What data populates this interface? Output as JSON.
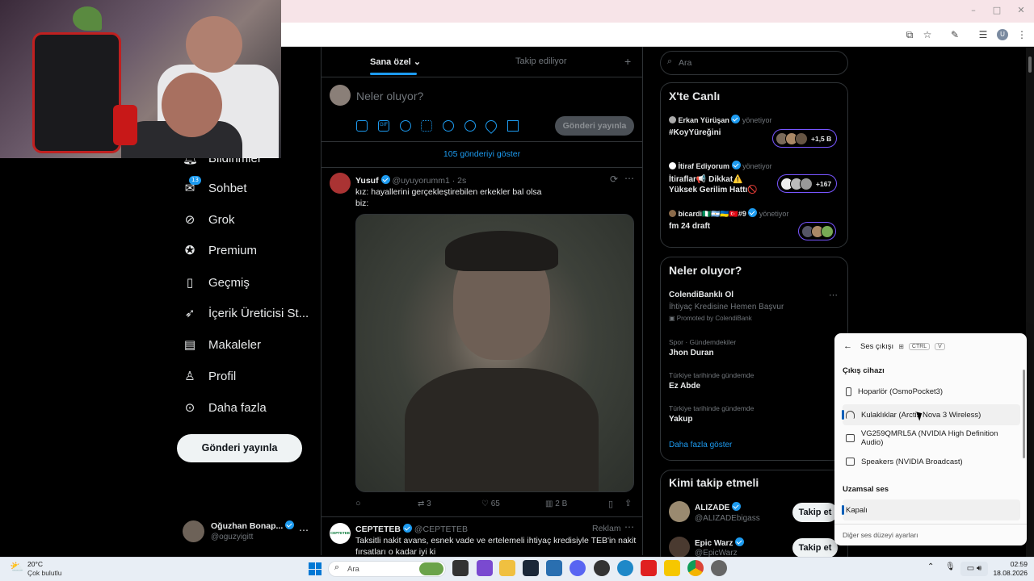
{
  "browser": {
    "window_controls": [
      "–",
      "□",
      "✕"
    ],
    "profile_initial": "U"
  },
  "timeline": {
    "tabs": [
      {
        "label": "Sana özel"
      },
      {
        "label": "Takip ediliyor"
      }
    ],
    "compose_placeholder": "Neler oluyor?",
    "compose_button": "Gönderi yayınla",
    "show_new": "105 gönderiyi göster",
    "posts": [
      {
        "name": "Yusuf",
        "handle": "@uyuyorumm1",
        "time": "· 2s",
        "text_line1": "kız: hayallerini gerçekleştirebilen erkekler bal olsa",
        "text_line2": "biz:",
        "retweets": "3",
        "likes": "65",
        "views": "2 B"
      },
      {
        "name": "CEPTETEB",
        "handle": "@CEPTETEB",
        "ad_label": "Reklam",
        "text_line1": "Taksitli nakit avans, esnek vade ve ertelemeli ihtiyaç kredisiyle TEB'in nakit",
        "text_line2": "fırsatları o kadar iyi ki",
        "avatar_text": "CEPTETEB"
      }
    ]
  },
  "nav": {
    "items": [
      {
        "label": "Bildirimler",
        "icon": "bell-icon"
      },
      {
        "label": "Sohbet",
        "icon": "chat-icon",
        "badge": "13"
      },
      {
        "label": "Grok",
        "icon": "grok-icon"
      },
      {
        "label": "Premium",
        "icon": "premium-icon"
      },
      {
        "label": "Geçmiş",
        "icon": "bookmark-icon"
      },
      {
        "label": "İçerik Üreticisi St...",
        "icon": "rocket-icon"
      },
      {
        "label": "Makaleler",
        "icon": "article-icon"
      },
      {
        "label": "Profil",
        "icon": "user-icon"
      },
      {
        "label": "Daha fazla",
        "icon": "more-icon"
      }
    ],
    "post_button": "Gönderi yayınla",
    "account": {
      "name": "Oğuzhan Bonap...",
      "handle": "@oguzyigitt"
    }
  },
  "sidebar": {
    "search_placeholder": "Ara",
    "live": {
      "title": "X'te Canlı",
      "items": [
        {
          "host": "Erkan Yürüşan",
          "role": "yönetiyor",
          "title_line1": "#KoyYüreğini",
          "title_line2": "",
          "count": "+1,5 B"
        },
        {
          "host": "İtiraf Ediyorum",
          "role": "yönetiyor",
          "title_line1": "İtiraflar📢 Dikkat⚠️",
          "title_line2": "Yüksek Gerilim Hattı🚫",
          "count": "+167"
        },
        {
          "host": "bicardi🇳🇬🇦🇷🇺🇦🇹🇷#9",
          "role": "yönetiyor",
          "title_line1": "fm 24 draft",
          "title_line2": "",
          "count": ""
        }
      ]
    },
    "trends": {
      "title": "Neler oluyor?",
      "promo": {
        "name": "ColendiBanklı Ol",
        "desc": "İhtiyaç Kredisine Hemen Başvur",
        "promoted": "Promoted by ColendiBank"
      },
      "items": [
        {
          "context": "Spor · Gündemdekiler",
          "name": "Jhon Duran"
        },
        {
          "context": "Türkiye tarihinde gündemde",
          "name": "Ez Abde"
        },
        {
          "context": "Türkiye tarihinde gündemde",
          "name": "Yakup"
        }
      ],
      "show_more": "Daha fazla göster"
    },
    "who_to_follow": {
      "title": "Kimi takip etmeli",
      "items": [
        {
          "name": "ALIZADE",
          "handle": "@ALIZADEbigass",
          "button": "Takip et"
        },
        {
          "name": "Epic Warz",
          "handle": "@EpicWarz",
          "button": "Takip et"
        }
      ]
    }
  },
  "sound_panel": {
    "title": "Ses çıkışı",
    "shortcut": [
      "CTRL",
      "V"
    ],
    "output_header": "Çıkış cihazı",
    "devices": [
      {
        "label": "Hoparlör (OsmoPocket3)",
        "icon": "speaker-icon",
        "selected": false
      },
      {
        "label": "Kulaklıklar (Arctis Nova 3 Wireless)",
        "icon": "headphones-icon",
        "selected": true
      },
      {
        "label": "VG259QMRL5A (NVIDIA High Definition Audio)",
        "icon": "monitor-icon",
        "selected": false
      },
      {
        "label": "Speakers (NVIDIA Broadcast)",
        "icon": "monitor-icon",
        "selected": false
      }
    ],
    "spatial_header": "Uzamsal ses",
    "spatial_value": "Kapalı",
    "more_settings": "Diğer ses düzeyi ayarları"
  },
  "taskbar": {
    "weather_temp": "20°C",
    "weather_desc": "Çok bulutlu",
    "search_placeholder": "Ara",
    "time": "02:59",
    "date": "18.08.2026"
  },
  "colors": {
    "accent": "#1d9bf0",
    "live_border": "#7856ff",
    "windows_accent": "#005fb8"
  }
}
